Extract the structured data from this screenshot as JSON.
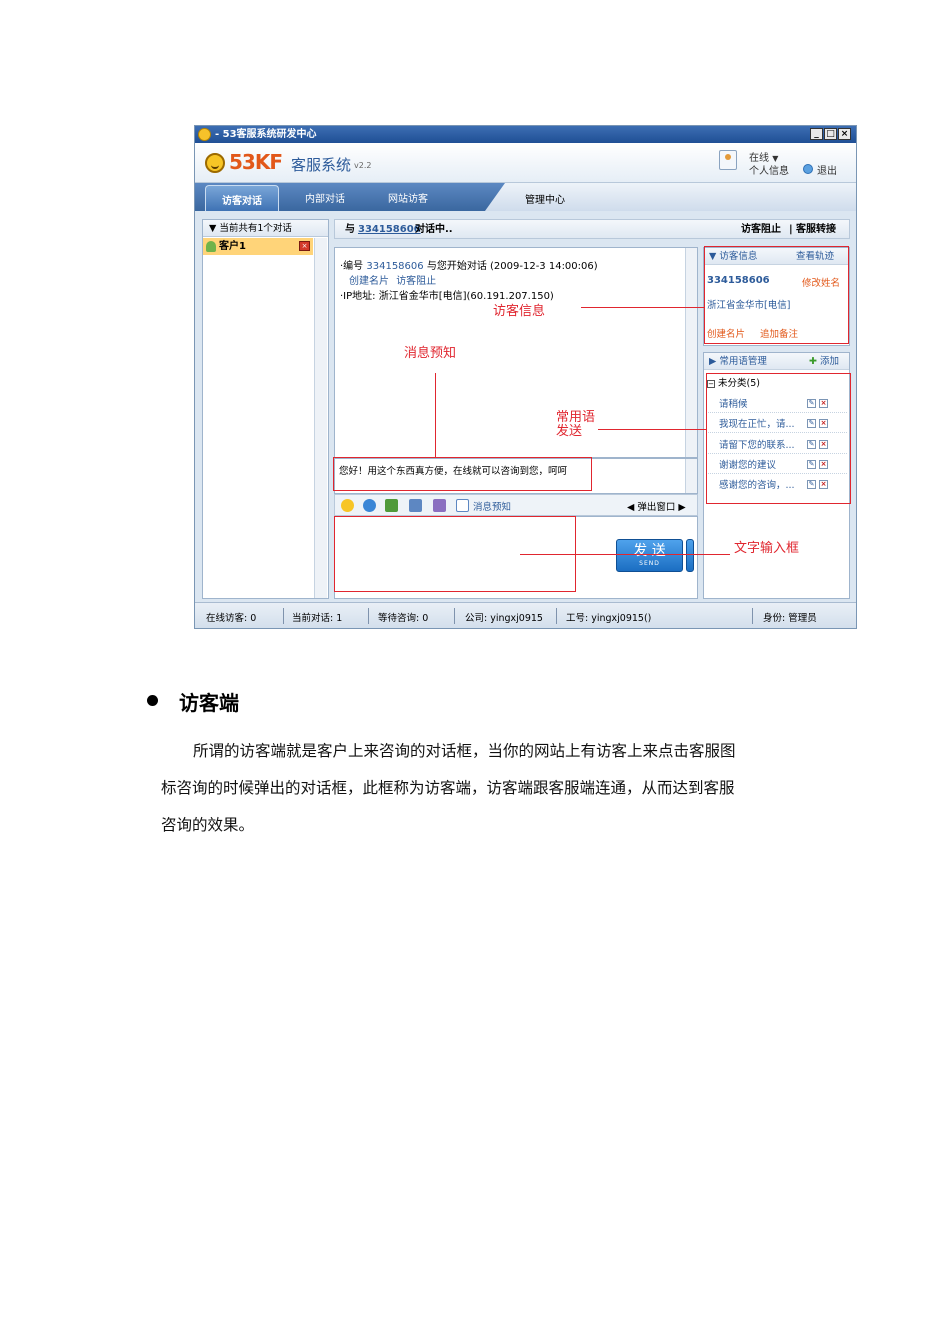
{
  "window": {
    "title": "- 53客服系统研发中心",
    "min_btn": "_",
    "max_btn": "□",
    "close_btn": "×"
  },
  "header": {
    "logo_brand": "53KF",
    "logo_sub": "客服系统",
    "logo_version": "v2.2",
    "status": "在线",
    "personal_info": "个人信息",
    "logout": "退出"
  },
  "tabs": [
    "访客对话",
    "内部对话",
    "网站访客",
    "管理中心"
  ],
  "left_panel": {
    "header": "▼ 当前共有1个对话",
    "item": "客户1"
  },
  "center": {
    "header_prefix": "与",
    "header_id": "334158606",
    "header_suffix": "对话中..",
    "block_visitor": "访客阻止",
    "transfer": "客服转接",
    "chat_line1_prefix": "·编号",
    "chat_line1_id": "334158606",
    "chat_line1_suffix": "与您开始对话 (2009-12-3 14:00:06)",
    "create_card": "创建名片",
    "block_link": "访客阻止",
    "ip_line": "·IP地址: 浙江省金华市[电信](60.191.207.150)",
    "preview_message": "您好！用这个东西真方便，在线就可以咨询到您，呵呵",
    "toolbar_preview": "消息预知",
    "popup_window": "◀ 弹出窗口 ▶",
    "send_label": "发 送",
    "send_sub": "SEND"
  },
  "visitor_info": {
    "header": "▼ 访客信息",
    "track": "查看轨迹",
    "id": "334158606",
    "edit_name": "修改姓名",
    "location": "浙江省金华市[电信]",
    "create_card": "创建名片",
    "add_note": "追加备注"
  },
  "phrases": {
    "header": "▶ 常用语管理",
    "add": "添加",
    "category": "未分类(5)",
    "items": [
      "请稍候",
      "我现在正忙，请...",
      "请留下您的联系...",
      "谢谢您的建议",
      "感谢您的咨询，..."
    ]
  },
  "status_bar": {
    "online_visitors": "在线访客: 0",
    "current_chats": "当前对话: 1",
    "waiting": "等待咨询: 0",
    "company": "公司: yingxj0915",
    "worker_id": "工号: yingxj0915()",
    "role": "身份: 管理员"
  },
  "annotations": {
    "visitor_info": "访客信息",
    "message_preview": "消息预知",
    "phrase_send_line1": "常用语",
    "phrase_send_line2": "发送",
    "text_input": "文字输入框"
  },
  "doc": {
    "heading": "访客端",
    "para_line1": "所谓的访客端就是客户上来咨询的对话框，当你的网站上有访客上来点击客服图",
    "para_line2": "标咨询的时候弹出的对话框，此框称为访客端，访客端跟客服端连通，从而达到客服",
    "para_line3": "咨询的效果。"
  },
  "colors": {
    "annotation_red": "#e0262f",
    "link_blue": "#2d5b9a",
    "accent_orange": "#e2581a"
  }
}
